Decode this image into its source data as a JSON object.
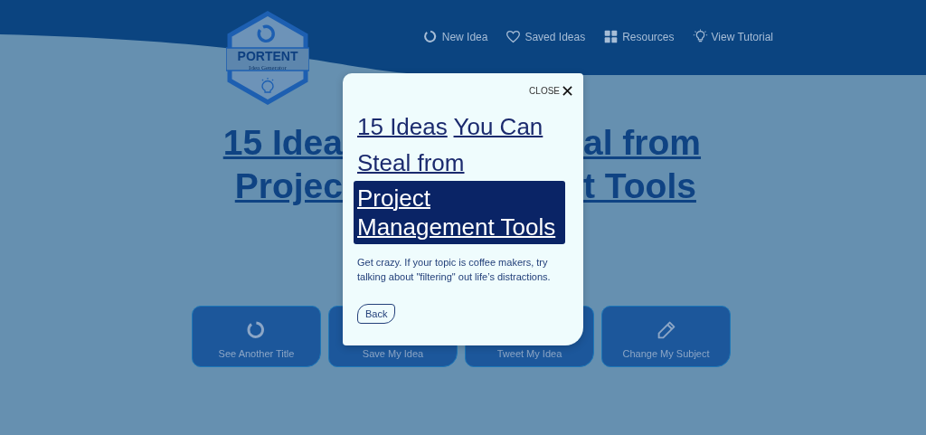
{
  "header": {
    "logo": {
      "name": "PORTENT",
      "tagline": "Idea Generator"
    },
    "nav": [
      {
        "label": "New Idea",
        "kind": "refresh"
      },
      {
        "label": "Saved Ideas",
        "kind": "heart"
      },
      {
        "label": "Resources",
        "kind": "grid"
      },
      {
        "label": "View Tutorial",
        "kind": "bulb"
      }
    ]
  },
  "headline": {
    "lines": [
      {
        "left": "15 Idea",
        "right": "al from"
      },
      {
        "left": "Projec",
        "right": "t Tools"
      }
    ]
  },
  "actions": [
    {
      "label": "See Another Title",
      "kind": "refresh"
    },
    {
      "label": "Save My Idea",
      "kind": "none"
    },
    {
      "label": "Tweet My Idea",
      "kind": "none"
    },
    {
      "label": "Change My Subject",
      "kind": "edit"
    }
  ],
  "modal": {
    "close": "CLOSE",
    "title": [
      {
        "text": "15 Ideas",
        "highlighted": false
      },
      {
        "text": "You Can",
        "highlighted": false
      },
      {
        "text": "Steal from",
        "highlighted": false
      },
      {
        "text": "Project Management Tools",
        "highlighted": true
      }
    ],
    "description": "Get crazy. If your topic is coffee makers, try talking about \"filtering\" out life’s distractions.",
    "back": "Back"
  }
}
